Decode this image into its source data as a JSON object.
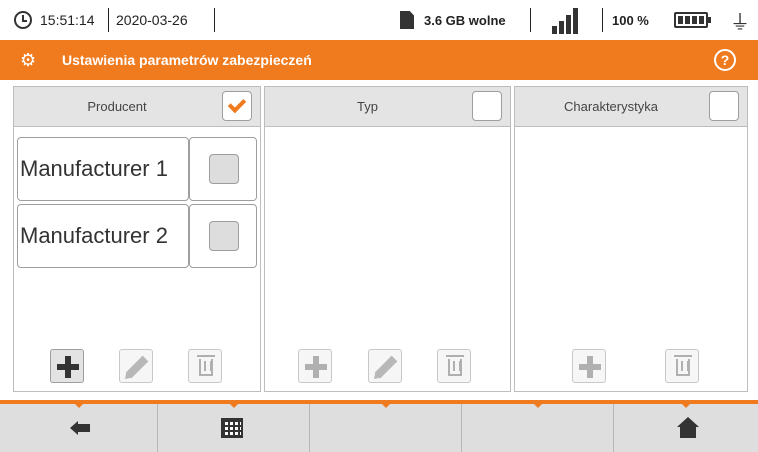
{
  "status": {
    "time": "15:51:14",
    "date": "2020-03-26",
    "storage": "3.6 GB wolne",
    "battery": "100 %"
  },
  "header": {
    "title": "Ustawienia parametrów zabezpieczeń",
    "help_symbol": "?"
  },
  "panels": {
    "producer": {
      "title": "Producent",
      "checked": true,
      "items": [
        {
          "label": "Manufacturer 1",
          "checked": false
        },
        {
          "label": "Manufacturer 2",
          "checked": false
        }
      ]
    },
    "type": {
      "title": "Typ",
      "checked": false
    },
    "characteristic": {
      "title": "Charakterystyka",
      "checked": false
    }
  },
  "colors": {
    "accent": "#f07a1e",
    "header_bg": "#e4e4e4",
    "bottom_bar": "#dedede"
  },
  "icons": {
    "status": [
      "clock-icon",
      "sd-card-icon",
      "signal-icon",
      "battery-icon",
      "plug-icon"
    ],
    "header": [
      "gear-icon",
      "help-icon"
    ],
    "bottom_nav": [
      "back-icon",
      "table-icon",
      "home-icon"
    ]
  }
}
